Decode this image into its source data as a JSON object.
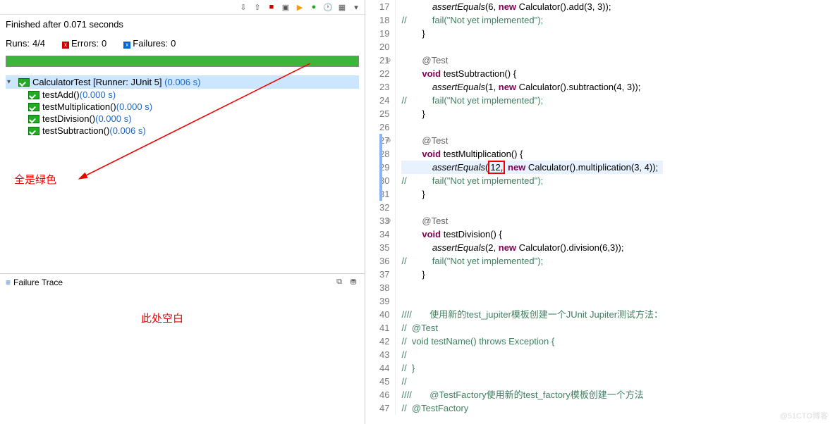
{
  "left": {
    "finished_text": "Finished after 0.071 seconds",
    "runs_label": "Runs:",
    "runs_value": "4/4",
    "errors_label": "Errors:",
    "errors_value": "0",
    "failures_label": "Failures:",
    "failures_value": "0",
    "tree": {
      "root": "CalculatorTest [Runner: JUnit 5]",
      "root_time": "(0.006 s)",
      "items": [
        {
          "name": "testAdd()",
          "time": "(0.000 s)"
        },
        {
          "name": "testMultiplication()",
          "time": "(0.000 s)"
        },
        {
          "name": "testDivision()",
          "time": "(0.000 s)"
        },
        {
          "name": "testSubtraction()",
          "time": "(0.006 s)"
        }
      ]
    },
    "annotation_all_green": "全是绿色",
    "failure_trace_label": "Failure Trace",
    "annotation_blank": "此处空白"
  },
  "code": {
    "lines": [
      {
        "n": 17,
        "indent": 3,
        "html": "<span class='mth'>assertEquals</span>(6, <span class='kw'>new</span> Calculator().add(3, 3));"
      },
      {
        "n": 18,
        "indent": 0,
        "html": "<span class='cmt'>//          fail(\"Not yet implemented\");</span>"
      },
      {
        "n": 19,
        "indent": 2,
        "html": "}"
      },
      {
        "n": 20,
        "indent": 0,
        "html": ""
      },
      {
        "n": 21,
        "indent": 2,
        "html": "<span class='ann'>@Test</span>",
        "fold": "⊖"
      },
      {
        "n": 22,
        "indent": 2,
        "html": "<span class='kw'>void</span> testSubtraction() {"
      },
      {
        "n": 23,
        "indent": 3,
        "html": "<span class='mth'>assertEquals</span>(1, <span class='kw'>new</span> Calculator().subtraction(4, 3));"
      },
      {
        "n": 24,
        "indent": 0,
        "html": "<span class='cmt'>//          fail(\"Not yet implemented\");</span>"
      },
      {
        "n": 25,
        "indent": 2,
        "html": "}"
      },
      {
        "n": 26,
        "indent": 0,
        "html": ""
      },
      {
        "n": 27,
        "indent": 2,
        "html": "<span class='ann'>@Test</span>",
        "fold": "⊖",
        "bar": true
      },
      {
        "n": 28,
        "indent": 2,
        "html": "<span class='kw'>void</span> testMultiplication() {",
        "bar": true
      },
      {
        "n": 29,
        "indent": 3,
        "html": "<span class='mth'>assertEquals</span>(<span class='redbox'>12,</span> <span class='kw'>new</span> Calculator().multiplication(3, 4));",
        "hl": true,
        "bar": true
      },
      {
        "n": 30,
        "indent": 0,
        "html": "<span class='cmt'>//          fail(\"Not yet implemented\");</span>",
        "bar": true
      },
      {
        "n": 31,
        "indent": 2,
        "html": "}",
        "bar": true
      },
      {
        "n": 32,
        "indent": 0,
        "html": ""
      },
      {
        "n": 33,
        "indent": 2,
        "html": "<span class='ann'>@Test</span>",
        "fold": "⊖"
      },
      {
        "n": 34,
        "indent": 2,
        "html": "<span class='kw'>void</span> testDivision() {"
      },
      {
        "n": 35,
        "indent": 3,
        "html": "<span class='mth'>assertEquals</span>(2, <span class='kw'>new</span> Calculator().division(6,3));"
      },
      {
        "n": 36,
        "indent": 0,
        "html": "<span class='cmt'>//          fail(\"Not yet implemented\");</span>"
      },
      {
        "n": 37,
        "indent": 2,
        "html": "}"
      },
      {
        "n": 38,
        "indent": 0,
        "html": ""
      },
      {
        "n": 39,
        "indent": 0,
        "html": ""
      },
      {
        "n": 40,
        "indent": 0,
        "html": "<span class='cmt'>////       使用新的test_jupiter模板创建一个JUnit Jupiter测试方法：</span>"
      },
      {
        "n": 41,
        "indent": 0,
        "html": "<span class='cmt'>//  @Test</span>"
      },
      {
        "n": 42,
        "indent": 0,
        "html": "<span class='cmt'>//  void testName() throws Exception {</span>"
      },
      {
        "n": 43,
        "indent": 0,
        "html": "<span class='cmt'>//</span>"
      },
      {
        "n": 44,
        "indent": 0,
        "html": "<span class='cmt'>//  }</span>"
      },
      {
        "n": 45,
        "indent": 0,
        "html": "<span class='cmt'>//</span>"
      },
      {
        "n": 46,
        "indent": 0,
        "html": "<span class='cmt'>////       @TestFactory使用新的test_factory模板创建一个方法</span>"
      },
      {
        "n": 47,
        "indent": 0,
        "html": "<span class='cmt'>//  @TestFactory</span>"
      }
    ]
  },
  "watermark": "@51CTO博客"
}
